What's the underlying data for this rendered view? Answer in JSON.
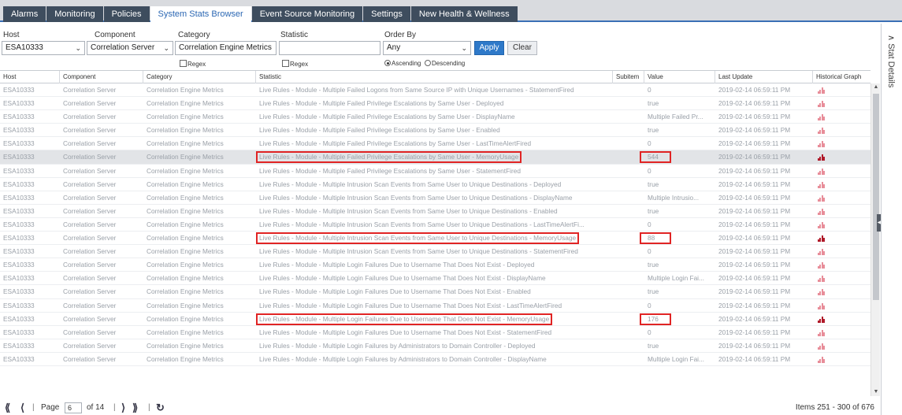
{
  "tabs": [
    {
      "label": "Alarms",
      "active": false
    },
    {
      "label": "Monitoring",
      "active": false
    },
    {
      "label": "Policies",
      "active": false
    },
    {
      "label": "System Stats Browser",
      "active": true
    },
    {
      "label": "Event Source Monitoring",
      "active": false
    },
    {
      "label": "Settings",
      "active": false
    },
    {
      "label": "New Health & Wellness",
      "active": false
    }
  ],
  "filters": {
    "host_label": "Host",
    "host_value": "ESA10333",
    "component_label": "Component",
    "component_value": "Correlation Server",
    "category_label": "Category",
    "category_value": "Correlation Engine Metrics",
    "category_regex": "Regex",
    "statistic_label": "Statistic",
    "statistic_value": "",
    "statistic_regex": "Regex",
    "order_label": "Order By",
    "order_value": "Any",
    "ascending": "Ascending",
    "descending": "Descending",
    "apply": "Apply",
    "clear": "Clear"
  },
  "columns": [
    "Host",
    "Component",
    "Category",
    "Statistic",
    "Subitem",
    "Value",
    "Last Update",
    "Historical Graph"
  ],
  "rows": [
    {
      "host": "ESA10333",
      "component": "Correlation Server",
      "category": "Correlation Engine Metrics",
      "statistic": "Live Rules - Module - Multiple Failed Logons from Same Source IP with Unique Usernames - StatementFired",
      "value": "0",
      "updated": "2019-02-14 06:59:11 PM",
      "highlight": false,
      "selected": false
    },
    {
      "host": "ESA10333",
      "component": "Correlation Server",
      "category": "Correlation Engine Metrics",
      "statistic": "Live Rules - Module - Multiple Failed Privilege Escalations by Same User - Deployed",
      "value": "true",
      "updated": "2019-02-14 06:59:11 PM",
      "highlight": false,
      "selected": false
    },
    {
      "host": "ESA10333",
      "component": "Correlation Server",
      "category": "Correlation Engine Metrics",
      "statistic": "Live Rules - Module - Multiple Failed Privilege Escalations by Same User - DisplayName",
      "value": "Multiple Failed Pr...",
      "updated": "2019-02-14 06:59:11 PM",
      "highlight": false,
      "selected": false
    },
    {
      "host": "ESA10333",
      "component": "Correlation Server",
      "category": "Correlation Engine Metrics",
      "statistic": "Live Rules - Module - Multiple Failed Privilege Escalations by Same User - Enabled",
      "value": "true",
      "updated": "2019-02-14 06:59:11 PM",
      "highlight": false,
      "selected": false
    },
    {
      "host": "ESA10333",
      "component": "Correlation Server",
      "category": "Correlation Engine Metrics",
      "statistic": "Live Rules - Module - Multiple Failed Privilege Escalations by Same User - LastTimeAlertFired",
      "value": "0",
      "updated": "2019-02-14 06:59:11 PM",
      "highlight": false,
      "selected": false
    },
    {
      "host": "ESA10333",
      "component": "Correlation Server",
      "category": "Correlation Engine Metrics",
      "statistic": "Live Rules - Module - Multiple Failed Privilege Escalations by Same User - MemoryUsage",
      "value": "544",
      "updated": "2019-02-14 06:59:11 PM",
      "highlight": true,
      "selected": true
    },
    {
      "host": "ESA10333",
      "component": "Correlation Server",
      "category": "Correlation Engine Metrics",
      "statistic": "Live Rules - Module - Multiple Failed Privilege Escalations by Same User - StatementFired",
      "value": "0",
      "updated": "2019-02-14 06:59:11 PM",
      "highlight": false,
      "selected": false
    },
    {
      "host": "ESA10333",
      "component": "Correlation Server",
      "category": "Correlation Engine Metrics",
      "statistic": "Live Rules - Module - Multiple Intrusion Scan Events from Same User to Unique Destinations - Deployed",
      "value": "true",
      "updated": "2019-02-14 06:59:11 PM",
      "highlight": false,
      "selected": false
    },
    {
      "host": "ESA10333",
      "component": "Correlation Server",
      "category": "Correlation Engine Metrics",
      "statistic": "Live Rules - Module - Multiple Intrusion Scan Events from Same User to Unique Destinations - DisplayName",
      "value": "Multiple Intrusio...",
      "updated": "2019-02-14 06:59:11 PM",
      "highlight": false,
      "selected": false
    },
    {
      "host": "ESA10333",
      "component": "Correlation Server",
      "category": "Correlation Engine Metrics",
      "statistic": "Live Rules - Module - Multiple Intrusion Scan Events from Same User to Unique Destinations - Enabled",
      "value": "true",
      "updated": "2019-02-14 06:59:11 PM",
      "highlight": false,
      "selected": false
    },
    {
      "host": "ESA10333",
      "component": "Correlation Server",
      "category": "Correlation Engine Metrics",
      "statistic": "Live Rules - Module - Multiple Intrusion Scan Events from Same User to Unique Destinations - LastTimeAlertFi...",
      "value": "0",
      "updated": "2019-02-14 06:59:11 PM",
      "highlight": false,
      "selected": false
    },
    {
      "host": "ESA10333",
      "component": "Correlation Server",
      "category": "Correlation Engine Metrics",
      "statistic": "Live Rules - Module - Multiple Intrusion Scan Events from Same User to Unique Destinations - MemoryUsage",
      "value": "88",
      "updated": "2019-02-14 06:59:11 PM",
      "highlight": true,
      "selected": false
    },
    {
      "host": "ESA10333",
      "component": "Correlation Server",
      "category": "Correlation Engine Metrics",
      "statistic": "Live Rules - Module - Multiple Intrusion Scan Events from Same User to Unique Destinations - StatementFired",
      "value": "0",
      "updated": "2019-02-14 06:59:11 PM",
      "highlight": false,
      "selected": false
    },
    {
      "host": "ESA10333",
      "component": "Correlation Server",
      "category": "Correlation Engine Metrics",
      "statistic": "Live Rules - Module - Multiple Login Failures Due to Username That Does Not Exist - Deployed",
      "value": "true",
      "updated": "2019-02-14 06:59:11 PM",
      "highlight": false,
      "selected": false
    },
    {
      "host": "ESA10333",
      "component": "Correlation Server",
      "category": "Correlation Engine Metrics",
      "statistic": "Live Rules - Module - Multiple Login Failures Due to Username That Does Not Exist - DisplayName",
      "value": "Multiple Login Fai...",
      "updated": "2019-02-14 06:59:11 PM",
      "highlight": false,
      "selected": false
    },
    {
      "host": "ESA10333",
      "component": "Correlation Server",
      "category": "Correlation Engine Metrics",
      "statistic": "Live Rules - Module - Multiple Login Failures Due to Username That Does Not Exist - Enabled",
      "value": "true",
      "updated": "2019-02-14 06:59:11 PM",
      "highlight": false,
      "selected": false
    },
    {
      "host": "ESA10333",
      "component": "Correlation Server",
      "category": "Correlation Engine Metrics",
      "statistic": "Live Rules - Module - Multiple Login Failures Due to Username That Does Not Exist - LastTimeAlertFired",
      "value": "0",
      "updated": "2019-02-14 06:59:11 PM",
      "highlight": false,
      "selected": false
    },
    {
      "host": "ESA10333",
      "component": "Correlation Server",
      "category": "Correlation Engine Metrics",
      "statistic": "Live Rules - Module - Multiple Login Failures Due to Username That Does Not Exist - MemoryUsage",
      "value": "176",
      "updated": "2019-02-14 06:59:11 PM",
      "highlight": true,
      "selected": false
    },
    {
      "host": "ESA10333",
      "component": "Correlation Server",
      "category": "Correlation Engine Metrics",
      "statistic": "Live Rules - Module - Multiple Login Failures Due to Username That Does Not Exist - StatementFired",
      "value": "0",
      "updated": "2019-02-14 06:59:11 PM",
      "highlight": false,
      "selected": false
    },
    {
      "host": "ESA10333",
      "component": "Correlation Server",
      "category": "Correlation Engine Metrics",
      "statistic": "Live Rules - Module - Multiple Login Failures by Administrators to Domain Controller - Deployed",
      "value": "true",
      "updated": "2019-02-14 06:59:11 PM",
      "highlight": false,
      "selected": false
    },
    {
      "host": "ESA10333",
      "component": "Correlation Server",
      "category": "Correlation Engine Metrics",
      "statistic": "Live Rules - Module - Multiple Login Failures by Administrators to Domain Controller - DisplayName",
      "value": "Multiple Login Fai...",
      "updated": "2019-02-14 06:59:11 PM",
      "highlight": false,
      "selected": false
    }
  ],
  "pager": {
    "first_icon": "double-chevron-left-icon",
    "prev_icon": "chevron-left-icon",
    "next_icon": "chevron-right-icon",
    "last_icon": "double-chevron-right-icon",
    "refresh_icon": "refresh-icon",
    "page_label": "Page",
    "page_value": "6",
    "of_label": "of 14",
    "items": "Items 251 - 300 of 676"
  },
  "side_panel": {
    "title": "Stat Details"
  },
  "colors": {
    "accent": "#2e79c9",
    "highlight_box": "#e02424",
    "graph_icon": "#e88e9a",
    "graph_icon_dark": "#b01a2a"
  }
}
